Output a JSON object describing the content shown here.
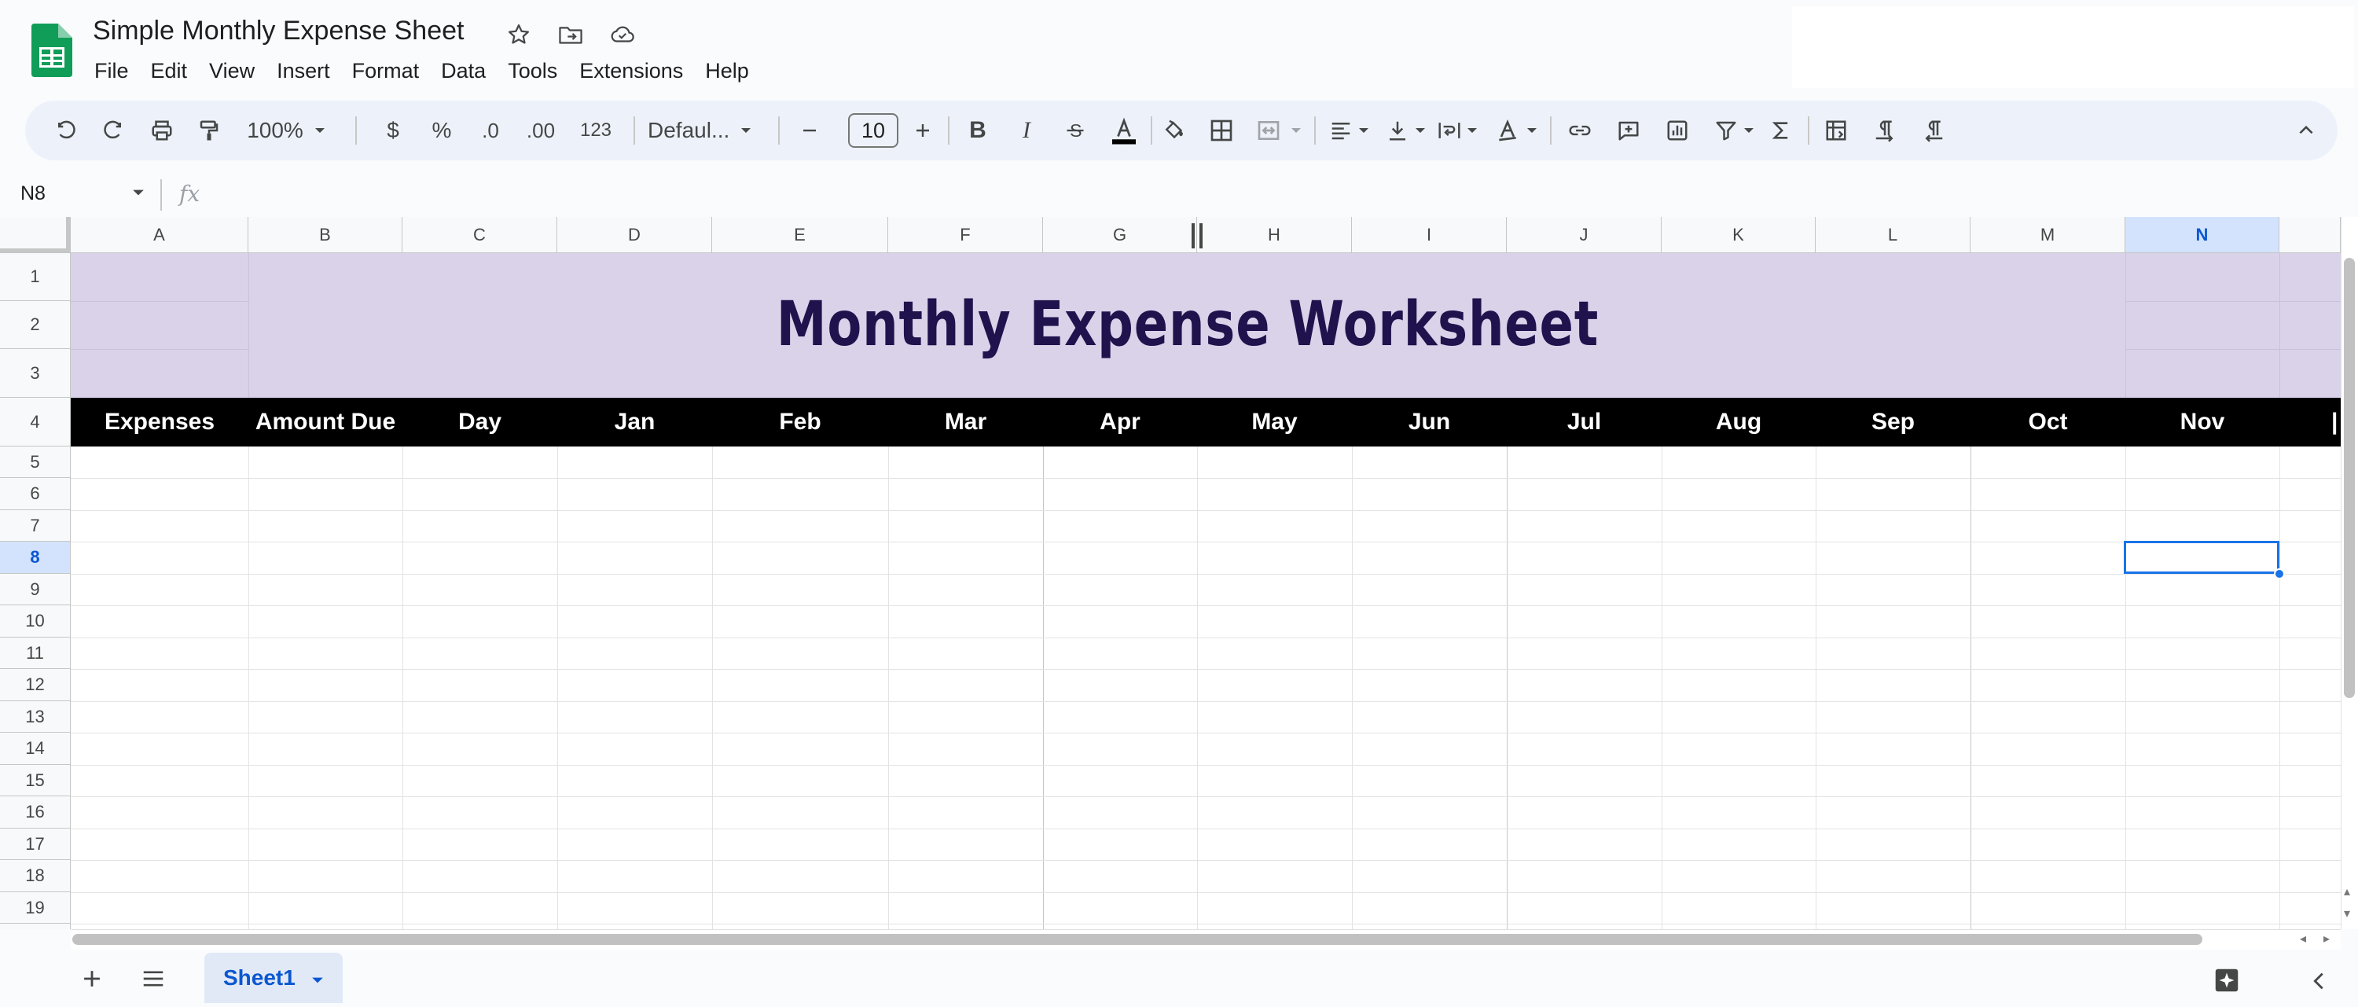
{
  "document": {
    "title": "Simple Monthly Expense Sheet"
  },
  "menu": [
    "File",
    "Edit",
    "View",
    "Insert",
    "Format",
    "Data",
    "Tools",
    "Extensions",
    "Help"
  ],
  "toolbar": {
    "zoom": "100%",
    "currency_label": "$",
    "percent_label": "%",
    "decrease_decimal_label": ".0",
    "increase_decimal_label": ".00",
    "more_formats_label": "123",
    "font_name": "Defaul...",
    "font_size": "10"
  },
  "formula_bar": {
    "name_box": "N8",
    "fx": "fx"
  },
  "columns": [
    "A",
    "B",
    "C",
    "D",
    "E",
    "F",
    "G",
    "H",
    "I",
    "J",
    "K",
    "L",
    "M",
    "N"
  ],
  "selected_column": "N",
  "rows": [
    "1",
    "2",
    "3",
    "4",
    "5",
    "6",
    "7",
    "8",
    "9",
    "10",
    "11",
    "12",
    "13",
    "14",
    "15",
    "16",
    "17",
    "18",
    "19"
  ],
  "selected_row": "8",
  "sheet": {
    "banner_title": "Monthly Expense Worksheet",
    "header_cells": [
      "Expenses",
      "Amount Due",
      "Day",
      "Jan",
      "Feb",
      "Mar",
      "Apr",
      "May",
      "Jun",
      "Jul",
      "Aug",
      "Sep",
      "Oct",
      "Nov"
    ],
    "banner_color": "#d9d2e9",
    "title_color": "#20124d",
    "header_row_color": "#000000"
  },
  "sheet_tabs": [
    {
      "label": "Sheet1",
      "active": true
    }
  ],
  "colors": {
    "accent": "#1a73e8",
    "selected_header": "#d3e3fd",
    "toolbar_bg": "#edf2fa"
  }
}
